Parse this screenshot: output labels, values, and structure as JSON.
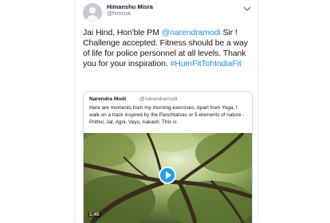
{
  "tweet": {
    "author_name": "Himanshu Misra",
    "author_handle": "@himisra",
    "text_prefix": "Jai Hind, Hon'ble PM ",
    "mention": "@narendramodi",
    "text_body": " Sir ! Challenge accepted. Fitness should be a way of life for police personnel at all levels. Thank you for your inspiration. ",
    "hashtag": "#HumFitTohIndiaFit"
  },
  "quoted_tweet": {
    "author_name": "Narendra Modi",
    "author_handle": "@narendramodi",
    "text": "Here are moments from my morning exercises. Apart from Yoga, I walk on a track inspired by the Panchtatvas or 5 elements of nature - Prithvi, Jal, Agni, Vayu, Aakash. This is",
    "video_duration": "1:48"
  },
  "icons": {
    "menu": "chevron-down-icon",
    "play": "play-icon",
    "avatar": "default-avatar-icon"
  },
  "colors": {
    "text": "#14171a",
    "secondary_text": "#657786",
    "link": "#1b95e0",
    "play_button": "#1da1f2",
    "border": "#ccd6dd"
  }
}
